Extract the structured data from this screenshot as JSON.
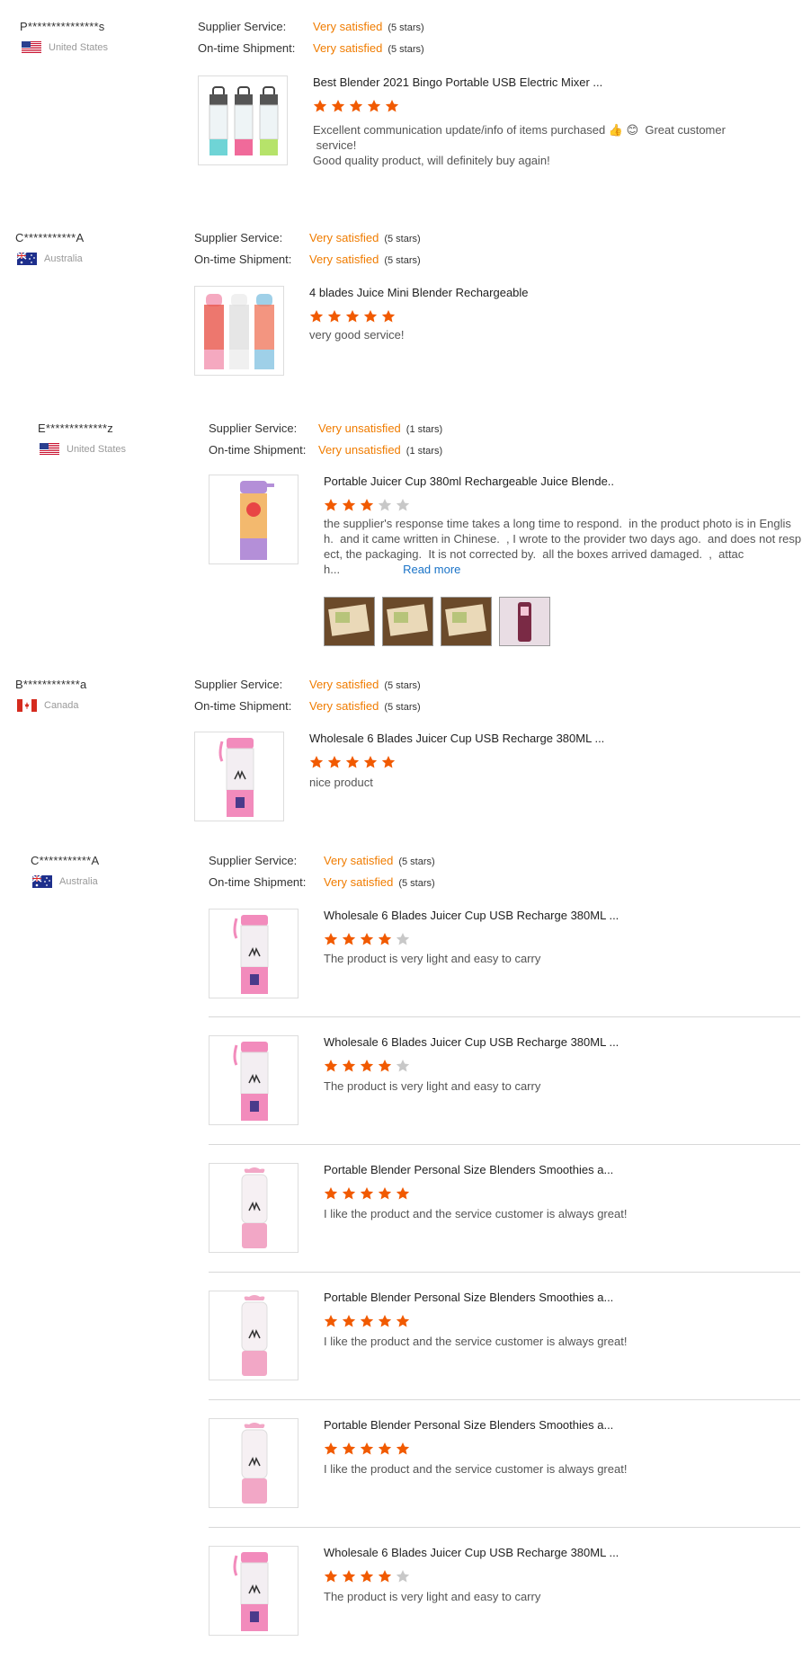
{
  "labels": {
    "supplier_service": "Supplier Service:",
    "on_time_shipment": "On-time Shipment:"
  },
  "colors": {
    "accent": "#f07c00",
    "star_filled": "#f15a00",
    "star_empty": "#c8c8c8",
    "link": "#1a73c7"
  },
  "reviews": [
    {
      "buyer": "P***************s",
      "country": "United States",
      "flag": "us-flag",
      "supplier_service": "Very satisfied",
      "supplier_stars": "(5 stars)",
      "shipment": "Very satisfied",
      "shipment_stars": "(5 stars)",
      "items": [
        {
          "title": "Best Blender 2021 Bingo Portable USB Electric Mixer ...",
          "rating": 5,
          "comment_lines": [
            "Excellent communication update/info of items purchased 👍 😊  Great customer",
            " service!",
            "Good quality product, will definitely buy again!"
          ],
          "thumb": "three-bottle-blender"
        }
      ]
    },
    {
      "buyer": "C***********A",
      "country": "Australia",
      "flag": "au-flag",
      "supplier_service": "Very satisfied",
      "supplier_stars": "(5 stars)",
      "shipment": "Very satisfied",
      "shipment_stars": "(5 stars)",
      "items": [
        {
          "title": "4 blades Juice Mini Blender Rechargeable",
          "rating": 5,
          "comment_lines": [
            "very good service!"
          ],
          "thumb": "juice-bottles"
        }
      ]
    },
    {
      "buyer": "E*************z",
      "country": "United States",
      "flag": "us-flag",
      "supplier_service": "Very unsatisfied",
      "supplier_stars": "(1 stars)",
      "shipment": "Very unsatisfied",
      "shipment_stars": "(1 stars)",
      "items": [
        {
          "title": "Portable Juicer Cup 380ml Rechargeable Juice Blende..",
          "rating": 3,
          "comment_lines": [
            "the supplier's response time takes a long time to respond.  in the product photo is in Englis",
            "h.  and it came written in Chinese.  , I wrote to the provider two days ago.  and does not resp",
            "ect, the packaging.  It is not corrected by.  all the boxes arrived damaged.  ,  attac",
            "h..."
          ],
          "read_more": "Read more",
          "thumb": "purple-juicer",
          "photos": [
            "photo-box-1",
            "photo-box-2",
            "photo-box-3",
            "photo-pink-juicer"
          ]
        }
      ]
    },
    {
      "buyer": "B************a",
      "country": "Canada",
      "flag": "ca-flag",
      "supplier_service": "Very satisfied",
      "supplier_stars": "(5 stars)",
      "shipment": "Very satisfied",
      "shipment_stars": "(5 stars)",
      "items": [
        {
          "title": "Wholesale 6 Blades Juicer Cup USB Recharge 380ML ...",
          "rating": 5,
          "comment_lines": [
            "nice product"
          ],
          "thumb": "pink-juicer"
        }
      ]
    },
    {
      "buyer": "C***********A",
      "country": "Australia",
      "flag": "au-flag",
      "supplier_service": "Very satisfied",
      "supplier_stars": "(5 stars)",
      "shipment": "Very satisfied",
      "shipment_stars": "(5 stars)",
      "items": [
        {
          "title": "Wholesale 6 Blades Juicer Cup USB Recharge 380ML ...",
          "rating": 4,
          "comment_lines": [
            "The product is very light and easy to carry"
          ],
          "thumb": "pink-juicer"
        },
        {
          "title": "Wholesale 6 Blades Juicer Cup USB Recharge 380ML ...",
          "rating": 4,
          "comment_lines": [
            "The product is very light and easy to carry"
          ],
          "thumb": "pink-juicer"
        },
        {
          "title": "Portable Blender Personal Size Blenders Smoothies a...",
          "rating": 5,
          "comment_lines": [
            "I like the product and the service customer is always great!"
          ],
          "thumb": "pink-bottle"
        },
        {
          "title": "Portable Blender Personal Size Blenders Smoothies a...",
          "rating": 5,
          "comment_lines": [
            "I like the product and the service customer is always great!"
          ],
          "thumb": "pink-bottle"
        },
        {
          "title": "Portable Blender Personal Size Blenders Smoothies a...",
          "rating": 5,
          "comment_lines": [
            "I like the product and the service customer is always great!"
          ],
          "thumb": "pink-bottle"
        },
        {
          "title": "Wholesale 6 Blades Juicer Cup USB Recharge 380ML ...",
          "rating": 4,
          "comment_lines": [
            "The product is very light and easy to carry"
          ],
          "thumb": "pink-juicer"
        }
      ]
    }
  ]
}
